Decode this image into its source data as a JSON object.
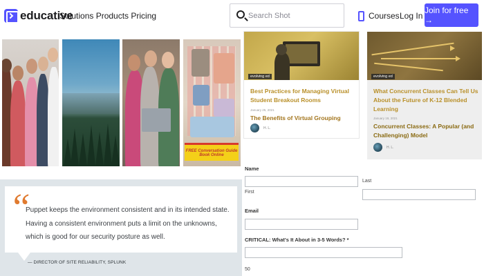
{
  "header": {
    "logo_text": "educative",
    "nav_links": "Solutions Products Pricing",
    "search_placeholder": "Search Shot",
    "courses_label": "Courses",
    "login_label": "Log In",
    "join_label": "Join for free →",
    "accent_color": "#5553ff"
  },
  "photos": {
    "book_banner_text": "FREE Conversation Guide Book Online"
  },
  "testimonial": {
    "quote_mark": "“",
    "text": "Puppet keeps the environment consistent and in its intended state. Having a consistent environment puts a limit on the unknowns, which is good for our security posture as well.",
    "author": "— DIRECTOR OF SITE RELIABILITY, SPLUNK",
    "accent_color": "#e07a2f"
  },
  "cards": [
    {
      "tag": "evolving ed",
      "title": "Best Practices for Managing Virtual Student Breakout Rooms",
      "date": "January 25, 2021",
      "subtitle": "The Benefits of Virtual Grouping",
      "author": "H. L."
    },
    {
      "tag": "evolving ed",
      "title": "What Concurrent Classes Can Tell Us About the Future of K-12 Blended Learning",
      "date": "January 19, 2021",
      "subtitle": "Concurrent Classes: A Popular (and Challenging) Model",
      "author": "H. L."
    }
  ],
  "form": {
    "name_label": "Name",
    "first_label": "First",
    "last_label": "Last",
    "email_label": "Email",
    "critical_label": "CRITICAL: What's It About in 3-5 Words? *",
    "char_count": "50"
  }
}
